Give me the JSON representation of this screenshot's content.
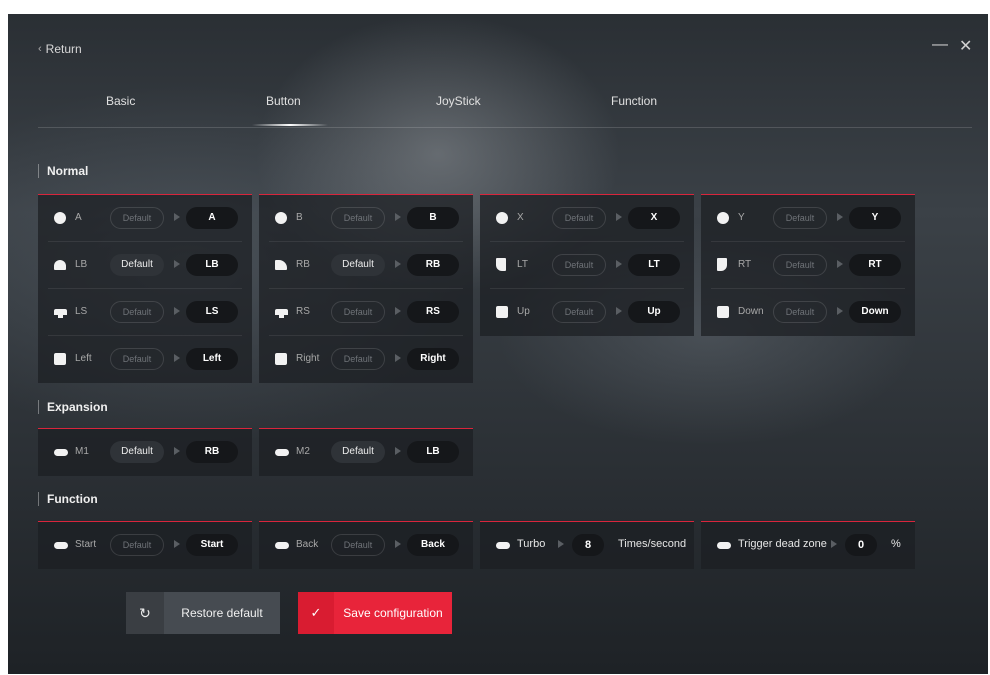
{
  "window": {
    "return_label": "Return",
    "minimize_glyph": "—",
    "close_glyph": "✕"
  },
  "tabs": [
    {
      "label": "Basic"
    },
    {
      "label": "Button",
      "selected": true
    },
    {
      "label": "JoyStick"
    },
    {
      "label": "Function"
    }
  ],
  "sections": {
    "normal": "Normal",
    "expansion": "Expansion",
    "function": "Function"
  },
  "normal": {
    "col1": [
      {
        "label": "A",
        "default": "Default",
        "value": "A",
        "icon": "circle-button-icon"
      },
      {
        "label": "LB",
        "default": "Default",
        "value": "LB",
        "icon": "left-bumper-icon",
        "active": true
      },
      {
        "label": "LS",
        "default": "Default",
        "value": "LS",
        "icon": "left-stick-icon"
      },
      {
        "label": "Left",
        "default": "Default",
        "value": "Left",
        "icon": "dpad-left-icon"
      }
    ],
    "col2": [
      {
        "label": "B",
        "default": "Default",
        "value": "B",
        "icon": "circle-button-icon"
      },
      {
        "label": "RB",
        "default": "Default",
        "value": "RB",
        "icon": "right-bumper-icon",
        "active": true
      },
      {
        "label": "RS",
        "default": "Default",
        "value": "RS",
        "icon": "right-stick-icon"
      },
      {
        "label": "Right",
        "default": "Default",
        "value": "Right",
        "icon": "dpad-right-icon"
      }
    ],
    "col3": [
      {
        "label": "X",
        "default": "Default",
        "value": "X",
        "icon": "circle-button-icon"
      },
      {
        "label": "LT",
        "default": "Default",
        "value": "LT",
        "icon": "left-trigger-icon"
      },
      {
        "label": "Up",
        "default": "Default",
        "value": "Up",
        "icon": "dpad-up-icon"
      }
    ],
    "col4": [
      {
        "label": "Y",
        "default": "Default",
        "value": "Y",
        "icon": "circle-button-icon"
      },
      {
        "label": "RT",
        "default": "Default",
        "value": "RT",
        "icon": "right-trigger-icon"
      },
      {
        "label": "Down",
        "default": "Default",
        "value": "Down",
        "icon": "dpad-down-icon"
      }
    ]
  },
  "expansion": [
    {
      "label": "M1",
      "default": "Default",
      "value": "RB",
      "active": true,
      "icon": "macro-pill-icon"
    },
    {
      "label": "M2",
      "default": "Default",
      "value": "LB",
      "active": true,
      "icon": "macro-pill-icon"
    }
  ],
  "function": {
    "start": {
      "label": "Start",
      "default": "Default",
      "value": "Start"
    },
    "back": {
      "label": "Back",
      "default": "Default",
      "value": "Back"
    },
    "turbo": {
      "label": "Turbo",
      "value": "8",
      "unit": "Times/second"
    },
    "deadzone": {
      "label": "Trigger dead zone",
      "value": "0",
      "unit": "%"
    }
  },
  "actions": {
    "restore_label": "Restore default",
    "restore_glyph": "↻",
    "save_label": "Save configuration",
    "save_glyph": "✓"
  },
  "colors": {
    "accent": "#e8243a",
    "panel_bg": "#1c1f23",
    "value_pill": "#15171a"
  }
}
